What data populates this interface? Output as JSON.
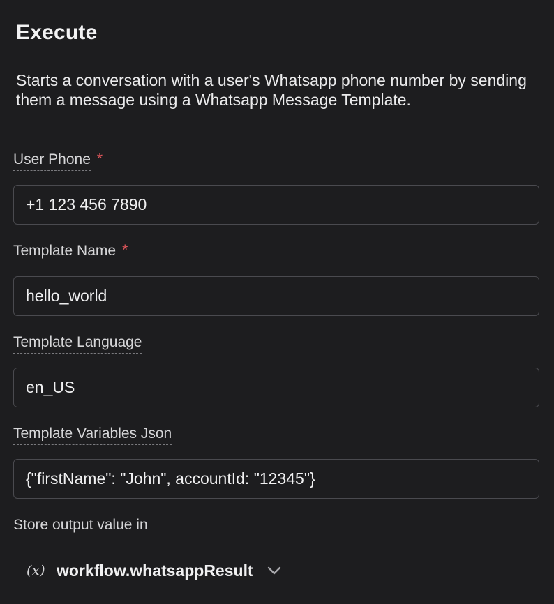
{
  "header": {
    "title": "Execute",
    "description": "Starts a conversation with a user's Whatsapp phone number by sending them a message using a Whatsapp Message Template."
  },
  "fields": {
    "user_phone": {
      "label": "User Phone",
      "required_marker": "*",
      "value": "+1 123 456 7890"
    },
    "template_name": {
      "label": "Template Name",
      "required_marker": "*",
      "value": "hello_world"
    },
    "template_language": {
      "label": "Template Language",
      "value": "en_US"
    },
    "template_variables_json": {
      "label": "Template Variables Json",
      "value": "{\"firstName\": \"John\", accountId: \"12345\"}"
    }
  },
  "output": {
    "label": "Store output value in",
    "variable_icon_text": "(x)",
    "variable_icon": "variable-icon",
    "value": "workflow.whatsappResult",
    "dropdown_icon": "chevron-down-icon"
  },
  "colors": {
    "background": "#1d1d1f",
    "required": "#e0565b",
    "border": "#4a4a4f"
  }
}
